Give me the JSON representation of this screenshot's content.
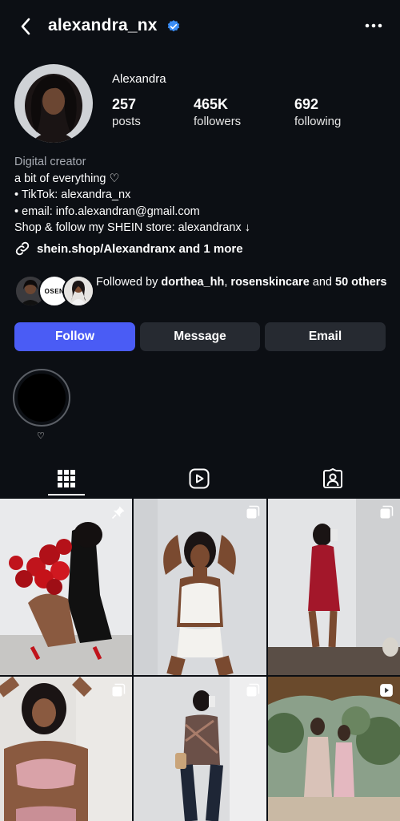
{
  "header": {
    "username": "alexandra_nx",
    "back_icon": "chevron-left-icon",
    "verified_icon": "verified-badge-icon",
    "more_icon": "more-horizontal-icon"
  },
  "profile": {
    "display_name": "Alexandra",
    "stats": [
      {
        "num": "257",
        "label": "posts"
      },
      {
        "num": "465K",
        "label": "followers"
      },
      {
        "num": "692",
        "label": "following"
      }
    ],
    "bio": {
      "category": "Digital creator",
      "lines": [
        "a bit of everything ♡",
        "• TikTok: alexandra_nx",
        "• email: info.alexandran@gmail.com",
        "Shop & follow my SHEIN store: alexandranx ↓"
      ]
    },
    "link_text": "shein.shop/Alexandranx and 1 more",
    "followed_by": {
      "prefix": "Followed by ",
      "user1": "dorthea_hh",
      "sep": ", ",
      "user2": "rosenskincare",
      "mid": " and ",
      "count": "50",
      "suffix": " others"
    },
    "follower_avatar_text": "OSEN"
  },
  "buttons": {
    "follow": "Follow",
    "message": "Message",
    "email": "Email"
  },
  "highlights": [
    {
      "label": "♡"
    }
  ],
  "tabs": [
    "grid-icon",
    "reels-icon",
    "tagged-icon"
  ],
  "grid": {
    "posts": [
      {
        "icon": "pin-icon"
      },
      {
        "icon": "carousel-icon"
      },
      {
        "icon": "carousel-icon"
      },
      {
        "icon": "carousel-icon"
      },
      {
        "icon": "carousel-icon"
      },
      {
        "icon": "reel-icon"
      }
    ]
  },
  "colors": {
    "background": "#0c0f14",
    "follow_button": "#4a5cf5",
    "secondary_button": "#262a31",
    "verified": "#3a8df5"
  }
}
